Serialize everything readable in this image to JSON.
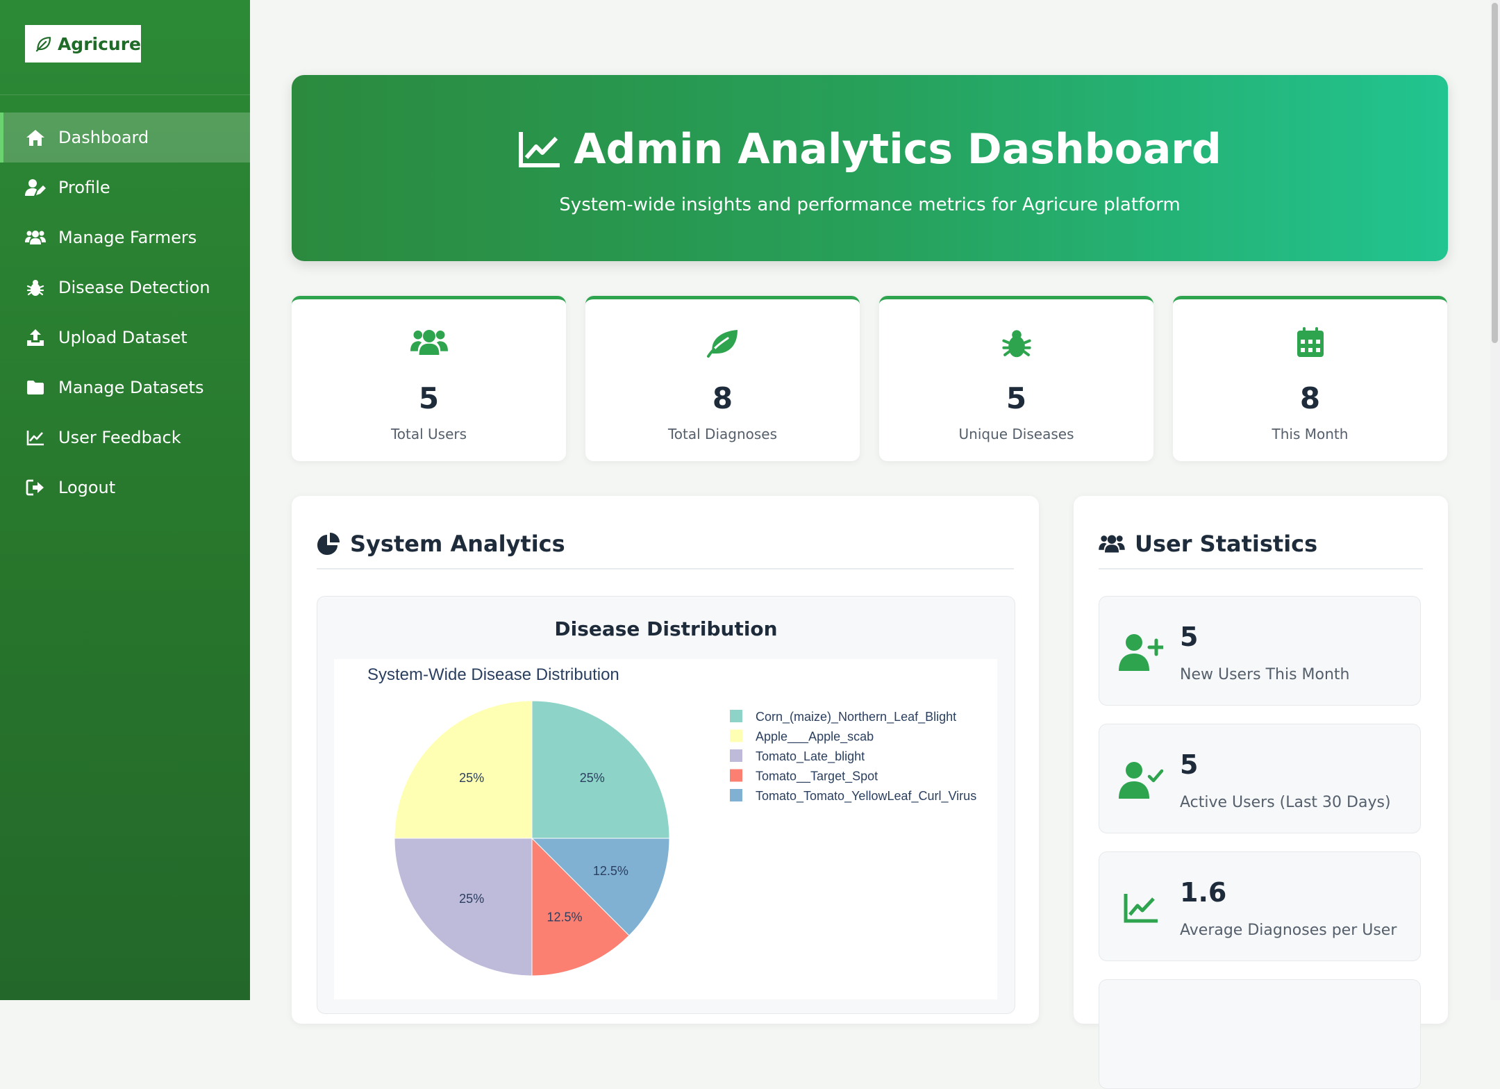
{
  "brand": {
    "name": "Agricure"
  },
  "sidebar": {
    "items": [
      {
        "label": "Dashboard",
        "icon": "home-icon",
        "active": true
      },
      {
        "label": "Profile",
        "icon": "user-edit-icon"
      },
      {
        "label": "Manage Farmers",
        "icon": "users-icon"
      },
      {
        "label": "Disease Detection",
        "icon": "bug-icon"
      },
      {
        "label": "Upload Dataset",
        "icon": "upload-icon"
      },
      {
        "label": "Manage Datasets",
        "icon": "folder-icon"
      },
      {
        "label": "User Feedback",
        "icon": "chart-line-icon"
      },
      {
        "label": "Logout",
        "icon": "logout-icon"
      }
    ]
  },
  "hero": {
    "title": "Admin Analytics Dashboard",
    "subtitle": "System-wide insights and performance metrics for Agricure platform"
  },
  "stats": [
    {
      "value": "5",
      "label": "Total Users",
      "icon": "users-icon"
    },
    {
      "value": "8",
      "label": "Total Diagnoses",
      "icon": "leaf-icon"
    },
    {
      "value": "5",
      "label": "Unique Diseases",
      "icon": "bug-icon"
    },
    {
      "value": "8",
      "label": "This Month",
      "icon": "calendar-icon"
    }
  ],
  "analytics": {
    "title": "System Analytics",
    "chart_heading": "Disease Distribution"
  },
  "chart_data": {
    "type": "pie",
    "title": "System-Wide Disease Distribution",
    "categories": [
      "Corn_(maize)_Northern_Leaf_Blight",
      "Apple___Apple_scab",
      "Tomato_Late_blight",
      "Tomato__Target_Spot",
      "Tomato_Tomato_YellowLeaf_Curl_Virus"
    ],
    "values": [
      25,
      25,
      25,
      12.5,
      12.5
    ],
    "labels": [
      "25%",
      "25%",
      "25%",
      "12.5%",
      "12.5%"
    ],
    "colors": [
      "#8dd3c7",
      "#ffffb3",
      "#bebada",
      "#fb8072",
      "#80b1d3"
    ],
    "legend": "right"
  },
  "user_stats": {
    "title": "User Statistics",
    "cards": [
      {
        "value": "5",
        "label": "New Users This Month",
        "icon": "user-plus-icon"
      },
      {
        "value": "5",
        "label": "Active Users (Last 30 Days)",
        "icon": "user-check-icon"
      },
      {
        "value": "1.6",
        "label": "Average Diagnoses per User",
        "icon": "chart-line-icon"
      }
    ]
  },
  "colors": {
    "primary": "#2c8a36",
    "accent": "#22c490",
    "icon_green": "#2fa44f"
  }
}
